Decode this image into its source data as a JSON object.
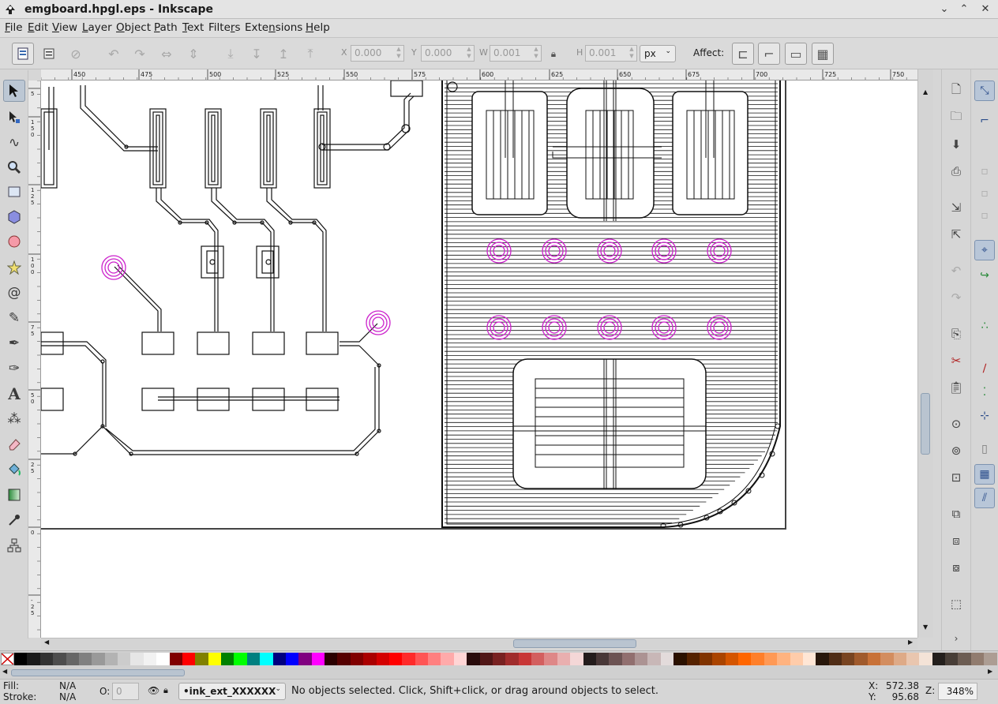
{
  "window": {
    "title": "emgboard.hpgl.eps - Inkscape",
    "controls": [
      "minimize-icon",
      "maximize-icon",
      "close-icon"
    ]
  },
  "menubar": {
    "items": [
      {
        "id": "file",
        "label": "File",
        "mnemonic": "F"
      },
      {
        "id": "edit",
        "label": "Edit",
        "mnemonic": "E"
      },
      {
        "id": "view",
        "label": "View",
        "mnemonic": "V"
      },
      {
        "id": "layer",
        "label": "Layer",
        "mnemonic": "L"
      },
      {
        "id": "object",
        "label": "Object",
        "mnemonic": "O"
      },
      {
        "id": "path",
        "label": "Path",
        "mnemonic": "P"
      },
      {
        "id": "text",
        "label": "Text",
        "mnemonic": "T"
      },
      {
        "id": "filters",
        "label": "Filters",
        "mnemonic": "r"
      },
      {
        "id": "extensions",
        "label": "Extensions",
        "mnemonic": "n"
      },
      {
        "id": "help",
        "label": "Help",
        "mnemonic": "H"
      }
    ]
  },
  "toolbar": {
    "x_label": "X",
    "x_value": "0.000",
    "y_label": "Y",
    "y_value": "0.000",
    "w_label": "W",
    "w_value": "0.001",
    "h_label": "H",
    "h_value": "0.001",
    "units": "px",
    "affect_label": "Affect:"
  },
  "ruler": {
    "h_ticks": [
      "450",
      "475",
      "500",
      "525",
      "550",
      "575",
      "600",
      "625",
      "650",
      "675",
      "700",
      "725",
      "750"
    ],
    "v_ticks": [
      "5",
      "1\n5\n0",
      "1\n2\n5",
      "1\n0\n0",
      "7\n5",
      "5\n0",
      "2\n5",
      "0",
      "-\n2\n5"
    ]
  },
  "status": {
    "fill_label": "Fill:",
    "fill_value": "N/A",
    "stroke_label": "Stroke:",
    "stroke_value": "N/A",
    "opacity_label": "O:",
    "opacity_value": "0",
    "layer_name": "•ink_ext_XXXXXX",
    "message": "No objects selected. Click, Shift+click, or drag around objects to select.",
    "x_label": "X:",
    "x_coord": "572.38",
    "y_label": "Y:",
    "y_coord": "95.68",
    "zoom_label": "Z:",
    "zoom": "348%"
  },
  "palette": [
    "#000000",
    "#1a1a1a",
    "#333333",
    "#4d4d4d",
    "#666666",
    "#808080",
    "#999999",
    "#b3b3b3",
    "#cccccc",
    "#e6e6e6",
    "#f2f2f2",
    "#ffffff",
    "#800000",
    "#ff0000",
    "#808000",
    "#ffff00",
    "#008000",
    "#00ff00",
    "#008080",
    "#00ffff",
    "#000080",
    "#0000ff",
    "#800080",
    "#ff00ff",
    "#2b0000",
    "#550000",
    "#800000",
    "#aa0000",
    "#d40000",
    "#ff0000",
    "#ff2a2a",
    "#ff5555",
    "#ff8080",
    "#ffaaaa",
    "#ffd5d5",
    "#280b0b",
    "#501616",
    "#782121",
    "#a02c2c",
    "#c83737",
    "#d35f5f",
    "#de8787",
    "#e9afaf",
    "#f4d7d7",
    "#241c1c",
    "#483737",
    "#6c5353",
    "#916f6f",
    "#ac9393",
    "#c8b7b7",
    "#e3dbdb",
    "#2b1100",
    "#552200",
    "#803300",
    "#aa4400",
    "#d45500",
    "#ff6600",
    "#ff7f2a",
    "#ff9955",
    "#ffb380",
    "#ffccaa",
    "#ffe6d5",
    "#28170b",
    "#502d16",
    "#784421",
    "#a05a2c",
    "#c87137",
    "#d38d5f",
    "#deaa87",
    "#e9c6af",
    "#f4e3d7",
    "#241f1c",
    "#483e37",
    "#6c5d53",
    "#917c6f",
    "#ac9d93"
  ]
}
